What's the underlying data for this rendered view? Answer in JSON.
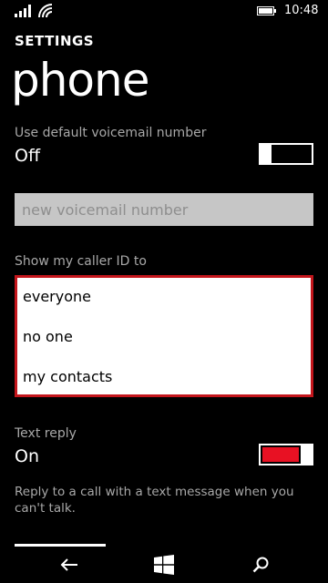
{
  "status_bar": {
    "time": "10:48",
    "signal_icon": "signal-icon",
    "wifi_icon": "wifi-icon",
    "battery_icon": "battery-icon"
  },
  "header": {
    "section": "SETTINGS",
    "title": "phone"
  },
  "voicemail": {
    "label": "Use default voicemail number",
    "state": "Off",
    "toggle_on": false,
    "placeholder": "new voicemail number",
    "value": ""
  },
  "caller_id": {
    "label": "Show my caller ID to",
    "options": [
      "everyone",
      "no one",
      "my contacts"
    ]
  },
  "text_reply": {
    "label": "Text reply",
    "state": "On",
    "toggle_on": true,
    "description": "Reply to a call with a text message when you can't talk."
  },
  "nav": {
    "back_icon": "back-arrow-icon",
    "start_icon": "windows-logo-icon",
    "search_icon": "search-icon"
  },
  "colors": {
    "accent": "#e81123",
    "list_border": "#c4161c",
    "background": "#000000",
    "label_gray": "#a8a8a8"
  }
}
